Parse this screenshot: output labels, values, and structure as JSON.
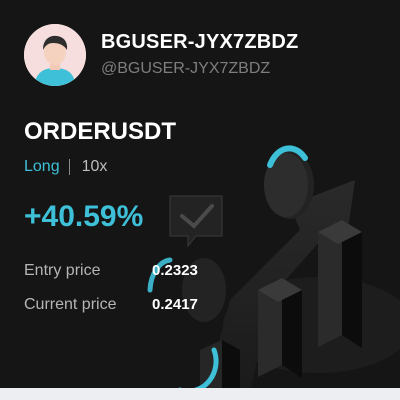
{
  "user": {
    "display_name": "BGUSER-JYX7ZBDZ",
    "handle": "@BGUSER-JYX7ZBDZ",
    "avatar_icon": "user-avatar-icon"
  },
  "position": {
    "symbol": "ORDERUSDT",
    "side": "Long",
    "leverage": "10x",
    "pnl_percent": "+40.59%",
    "entry_label": "Entry price",
    "entry_value": "0.2323",
    "current_label": "Current price",
    "current_value": "0.2417"
  },
  "colors": {
    "background": "#151515",
    "accent": "#3ec0d8",
    "muted": "#7e7e7e"
  }
}
